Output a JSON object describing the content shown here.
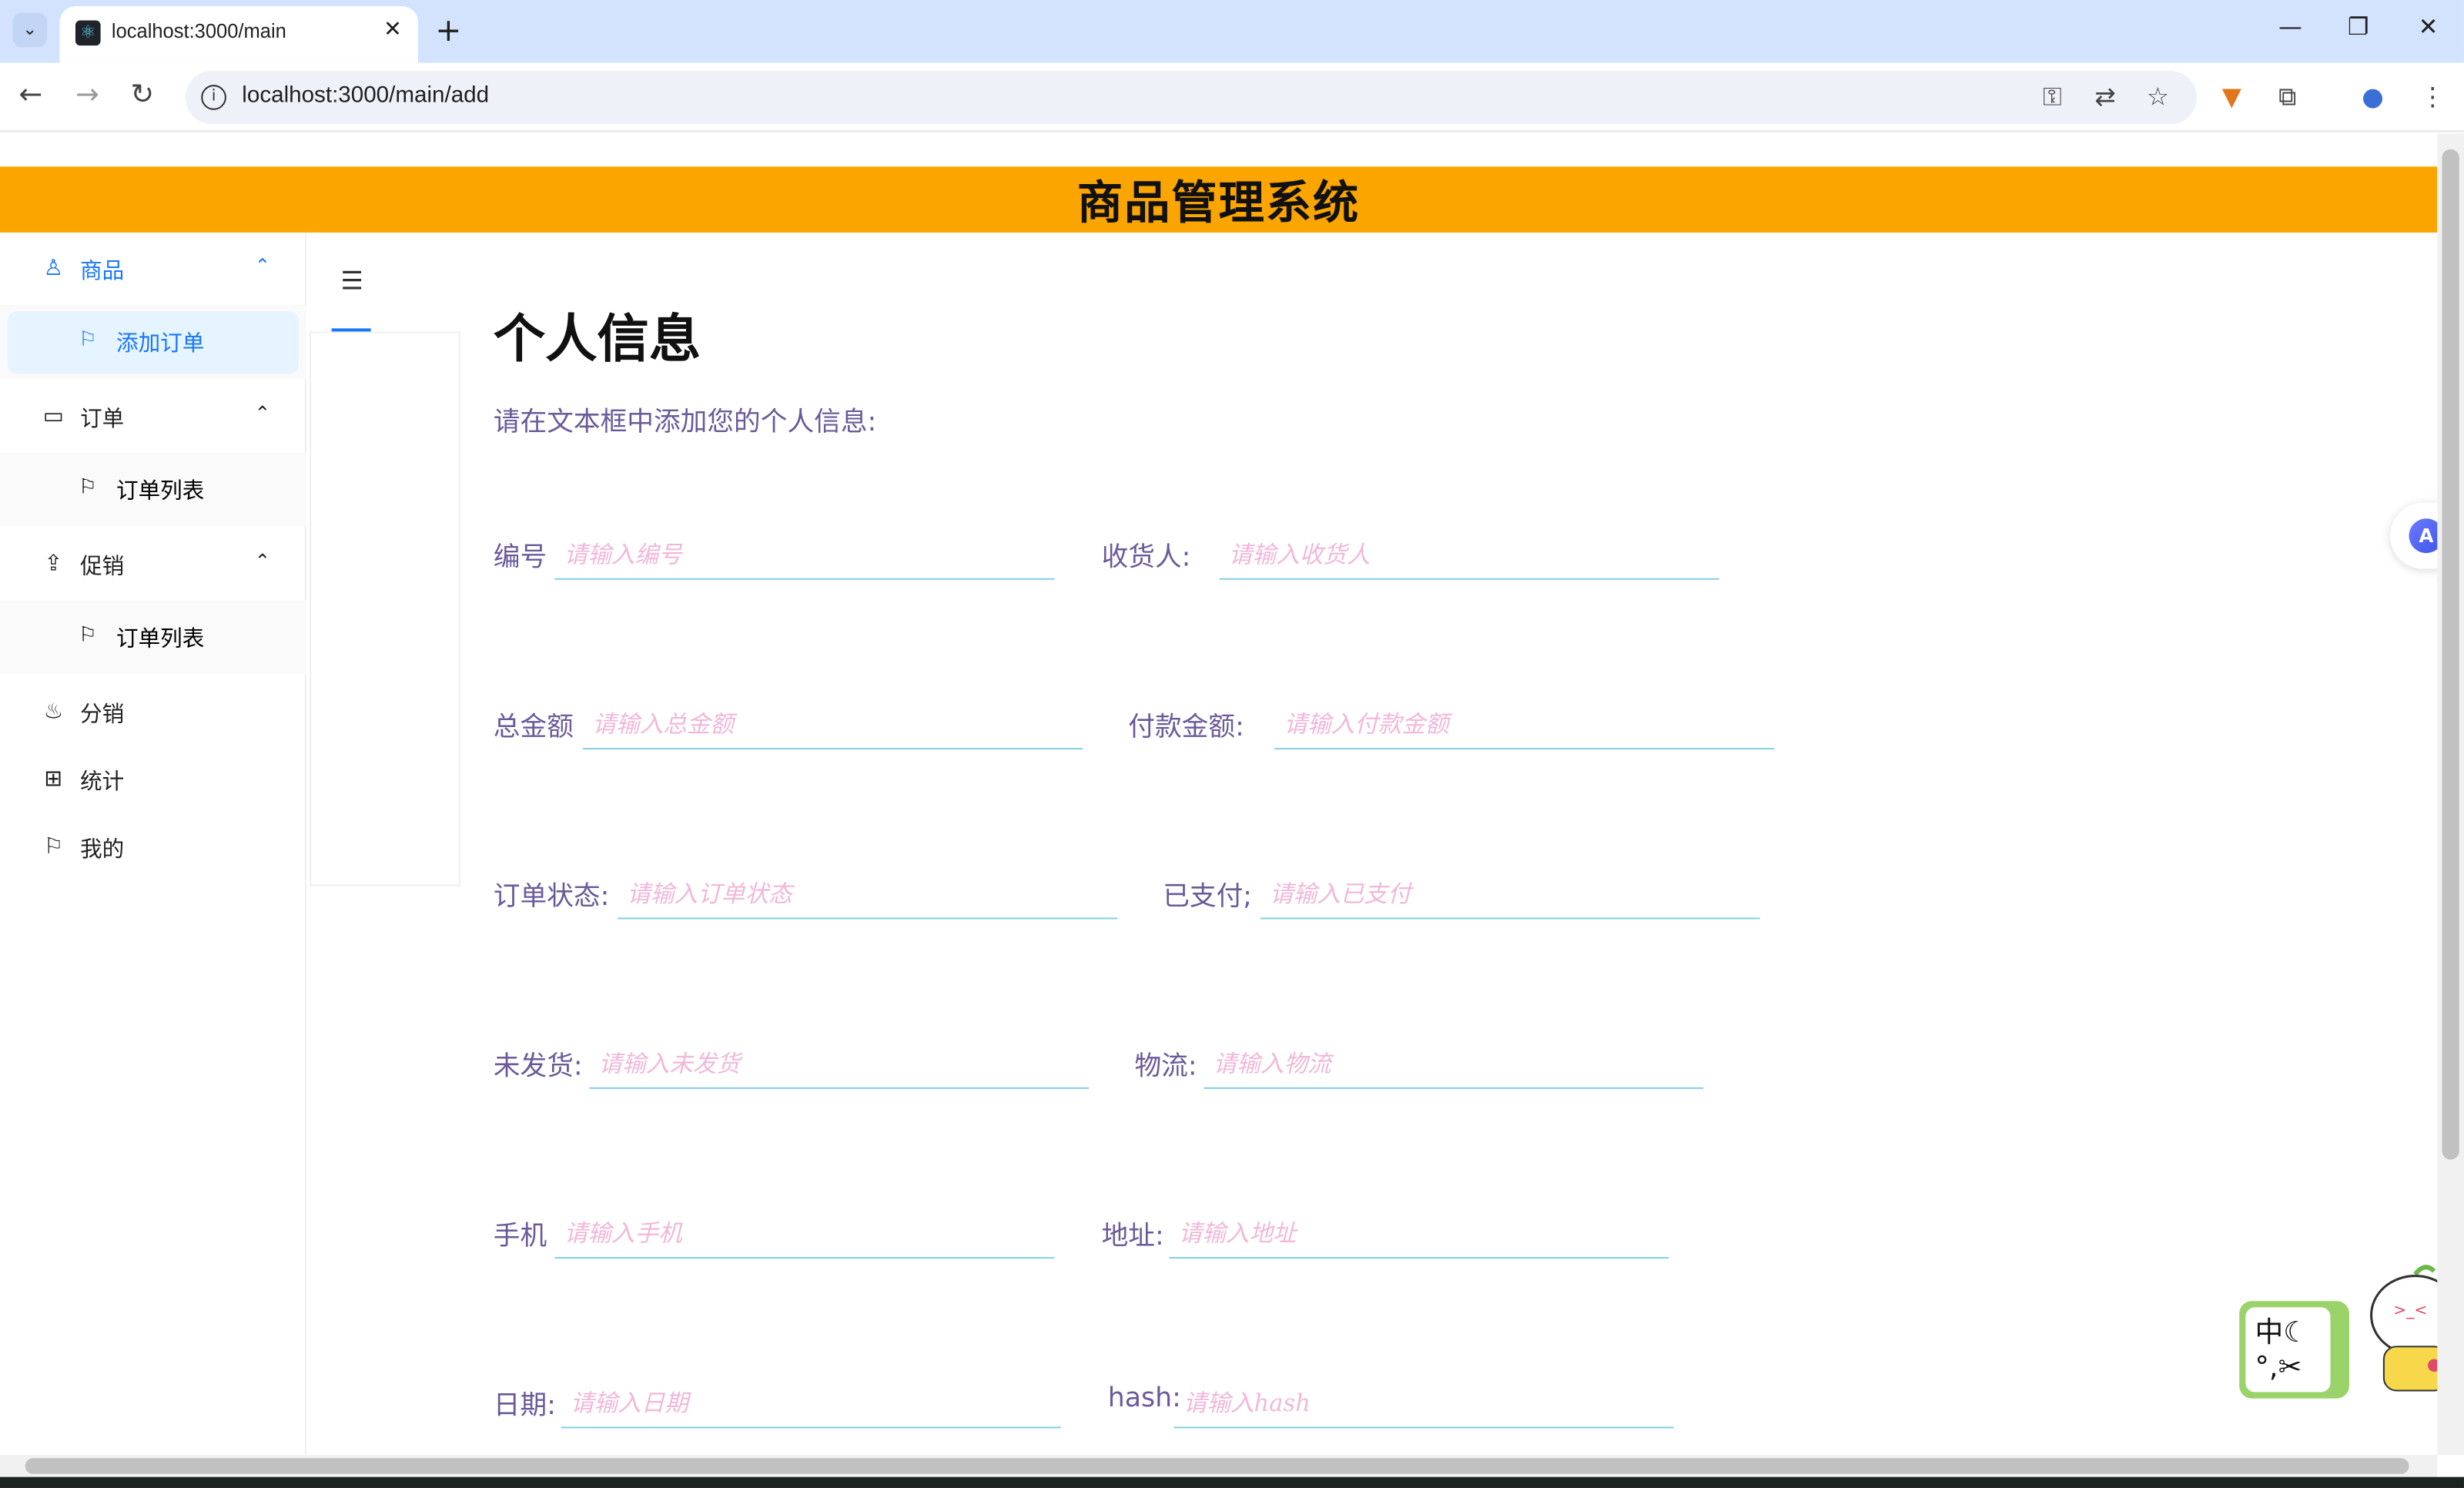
{
  "browser": {
    "tab_title": "localhost:3000/main",
    "tab_close": "✕",
    "new_tab": "+",
    "url": "localhost:3000/main/add",
    "window_controls": {
      "minimize": "—",
      "restore": "❐",
      "close": "✕"
    },
    "icons": [
      "key-icon",
      "translate-icon",
      "star-icon",
      "fox-extension-icon",
      "puzzle-extension-icon",
      "profile-icon",
      "more-icon"
    ]
  },
  "header": {
    "title": "商品管理系统"
  },
  "sidebar": {
    "items": [
      {
        "label": "商品",
        "icon": "user-icon",
        "arrow": "⌃"
      },
      {
        "label": "添加订单",
        "icon": "flag-icon"
      },
      {
        "label": "订单",
        "icon": "video-icon",
        "arrow": "⌃"
      },
      {
        "label": "订单列表",
        "icon": "flag-icon"
      },
      {
        "label": "促销",
        "icon": "upload-icon",
        "arrow": "⌃"
      },
      {
        "label": "订单列表",
        "icon": "flag-icon"
      },
      {
        "label": "分销",
        "icon": "fire-icon"
      },
      {
        "label": "统计",
        "icon": "gift-icon"
      },
      {
        "label": "我的",
        "icon": "flag-icon"
      }
    ]
  },
  "content": {
    "title": "个人信息",
    "lead": "请在文本框中添加您的个人信息:",
    "fields": [
      {
        "label": "编号",
        "placeholder": "请输入编号"
      },
      {
        "label": "收货人:",
        "placeholder": "请输入收货人"
      },
      {
        "label": "总金额",
        "placeholder": "请输入总金额"
      },
      {
        "label": "付款金额:",
        "placeholder": "请输入付款金额"
      },
      {
        "label": "订单状态:",
        "placeholder": "请输入订单状态"
      },
      {
        "label": "已支付;",
        "placeholder": "请输入已支付"
      },
      {
        "label": "未发货:",
        "placeholder": "请输入未发货"
      },
      {
        "label": "物流:",
        "placeholder": "请输入物流"
      },
      {
        "label": "手机",
        "placeholder": "请输入手机"
      },
      {
        "label": "地址:",
        "placeholder": "请输入地址"
      },
      {
        "label": "日期:",
        "placeholder": "请输入日期"
      },
      {
        "label": "hash:",
        "placeholder": "请输入hash"
      }
    ]
  },
  "ime": {
    "line1": "中☾",
    "line2": "°,✂"
  },
  "colors": {
    "header": "#faa500",
    "accent": "#1677ff",
    "label": "#6a5a9a",
    "placeholder": "#f1b7d9",
    "underline": "#85d0e5"
  }
}
